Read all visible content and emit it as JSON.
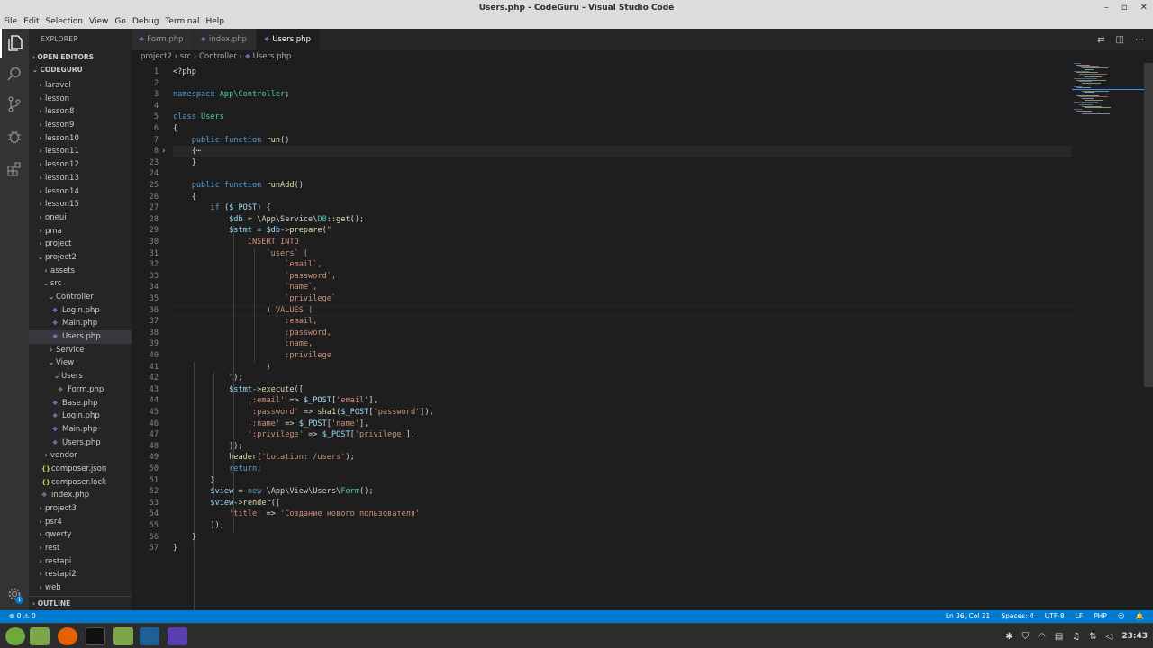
{
  "window": {
    "title": "Users.php - CodeGuru - Visual Studio Code"
  },
  "menu": [
    "File",
    "Edit",
    "Selection",
    "View",
    "Go",
    "Debug",
    "Terminal",
    "Help"
  ],
  "explorer": {
    "title": "EXPLORER",
    "open_editors": "OPEN EDITORS",
    "workspace": "CODEGURU",
    "outline": "OUTLINE",
    "items": [
      {
        "label": "laravel",
        "type": "folder"
      },
      {
        "label": "lesson",
        "type": "folder"
      },
      {
        "label": "lesson8",
        "type": "folder"
      },
      {
        "label": "lesson9",
        "type": "folder"
      },
      {
        "label": "lesson10",
        "type": "folder"
      },
      {
        "label": "lesson11",
        "type": "folder"
      },
      {
        "label": "lesson12",
        "type": "folder"
      },
      {
        "label": "lesson13",
        "type": "folder"
      },
      {
        "label": "lesson14",
        "type": "folder"
      },
      {
        "label": "lesson15",
        "type": "folder"
      },
      {
        "label": "oneui",
        "type": "folder"
      },
      {
        "label": "pma",
        "type": "folder"
      },
      {
        "label": "project",
        "type": "folder"
      },
      {
        "label": "project2",
        "type": "folder-open"
      },
      {
        "label": "assets",
        "type": "folder"
      },
      {
        "label": "src",
        "type": "folder-open"
      },
      {
        "label": "Controller",
        "type": "folder-open"
      },
      {
        "label": "Login.php",
        "type": "php"
      },
      {
        "label": "Main.php",
        "type": "php"
      },
      {
        "label": "Users.php",
        "type": "php",
        "selected": true
      },
      {
        "label": "Service",
        "type": "folder"
      },
      {
        "label": "View",
        "type": "folder-open"
      },
      {
        "label": "Users",
        "type": "folder-open"
      },
      {
        "label": "Form.php",
        "type": "php"
      },
      {
        "label": "Base.php",
        "type": "php"
      },
      {
        "label": "Login.php",
        "type": "php"
      },
      {
        "label": "Main.php",
        "type": "php"
      },
      {
        "label": "Users.php",
        "type": "php"
      },
      {
        "label": "vendor",
        "type": "folder"
      },
      {
        "label": "composer.json",
        "type": "json"
      },
      {
        "label": "composer.lock",
        "type": "json"
      },
      {
        "label": "index.php",
        "type": "php"
      },
      {
        "label": "project3",
        "type": "folder"
      },
      {
        "label": "psr4",
        "type": "folder"
      },
      {
        "label": "qwerty",
        "type": "folder"
      },
      {
        "label": "rest",
        "type": "folder"
      },
      {
        "label": "restapi",
        "type": "folder"
      },
      {
        "label": "restapi2",
        "type": "folder"
      },
      {
        "label": "web",
        "type": "folder"
      }
    ]
  },
  "tabs": [
    {
      "label": "Form.php"
    },
    {
      "label": "index.php"
    },
    {
      "label": "Users.php",
      "active": true
    }
  ],
  "breadcrumb": {
    "p1": "project2",
    "p2": "src",
    "p3": "Controller",
    "p4": "Users.php"
  },
  "code": [
    {
      "n": "1",
      "t": [
        [
          "p",
          "<?php"
        ]
      ]
    },
    {
      "n": "2",
      "t": []
    },
    {
      "n": "3",
      "t": [
        [
          "k",
          "namespace "
        ],
        [
          "c",
          "App\\Controller"
        ],
        [
          "p",
          ";"
        ]
      ]
    },
    {
      "n": "4",
      "t": []
    },
    {
      "n": "5",
      "t": [
        [
          "k",
          "class "
        ],
        [
          "c",
          "Users"
        ]
      ]
    },
    {
      "n": "6",
      "t": [
        [
          "p",
          "{"
        ]
      ]
    },
    {
      "n": "7",
      "t": [
        [
          "p",
          "    "
        ],
        [
          "k",
          "public function "
        ],
        [
          "f",
          "run"
        ],
        [
          "p",
          "()"
        ]
      ]
    },
    {
      "n": "8",
      "t": [
        [
          "p",
          "    {⋯"
        ]
      ]
    },
    {
      "n": "23",
      "t": [
        [
          "p",
          "    }"
        ]
      ]
    },
    {
      "n": "24",
      "t": []
    },
    {
      "n": "25",
      "t": [
        [
          "p",
          "    "
        ],
        [
          "k",
          "public function "
        ],
        [
          "f",
          "runAdd"
        ],
        [
          "p",
          "()"
        ]
      ]
    },
    {
      "n": "26",
      "t": [
        [
          "p",
          "    {"
        ]
      ]
    },
    {
      "n": "27",
      "t": [
        [
          "p",
          "        "
        ],
        [
          "k",
          "if "
        ],
        [
          "p",
          "("
        ],
        [
          "v",
          "$_POST"
        ],
        [
          "p",
          ") {"
        ]
      ]
    },
    {
      "n": "28",
      "t": [
        [
          "p",
          "            "
        ],
        [
          "v",
          "$db"
        ],
        [
          "p",
          " = \\App\\Service\\"
        ],
        [
          "c",
          "DB"
        ],
        [
          "p",
          "::"
        ],
        [
          "f",
          "get"
        ],
        [
          "p",
          "();"
        ]
      ]
    },
    {
      "n": "29",
      "t": [
        [
          "p",
          "            "
        ],
        [
          "v",
          "$stmt"
        ],
        [
          "p",
          " = "
        ],
        [
          "v",
          "$db"
        ],
        [
          "p",
          "->"
        ],
        [
          "f",
          "prepare"
        ],
        [
          "p",
          "("
        ],
        [
          "s",
          "\""
        ]
      ]
    },
    {
      "n": "30",
      "t": [
        [
          "s",
          "                INSERT INTO"
        ]
      ]
    },
    {
      "n": "31",
      "t": [
        [
          "s",
          "                    `users` ("
        ]
      ]
    },
    {
      "n": "32",
      "t": [
        [
          "s",
          "                        `email`,"
        ]
      ]
    },
    {
      "n": "33",
      "t": [
        [
          "s",
          "                        `password`,"
        ]
      ]
    },
    {
      "n": "34",
      "t": [
        [
          "s",
          "                        `name`,"
        ]
      ]
    },
    {
      "n": "35",
      "t": [
        [
          "s",
          "                        `privilege`"
        ]
      ]
    },
    {
      "n": "36",
      "t": [
        [
          "s",
          "                    ) VALUES ("
        ]
      ]
    },
    {
      "n": "37",
      "t": [
        [
          "s",
          "                        :email,"
        ]
      ]
    },
    {
      "n": "38",
      "t": [
        [
          "s",
          "                        :password,"
        ]
      ]
    },
    {
      "n": "39",
      "t": [
        [
          "s",
          "                        :name,"
        ]
      ]
    },
    {
      "n": "40",
      "t": [
        [
          "s",
          "                        :privilege"
        ]
      ]
    },
    {
      "n": "41",
      "t": [
        [
          "s",
          "                    )"
        ]
      ]
    },
    {
      "n": "42",
      "t": [
        [
          "s",
          "            \""
        ],
        [
          "p",
          ");"
        ]
      ]
    },
    {
      "n": "43",
      "t": [
        [
          "p",
          "            "
        ],
        [
          "v",
          "$stmt"
        ],
        [
          "p",
          "->"
        ],
        [
          "f",
          "execute"
        ],
        [
          "p",
          "(["
        ]
      ]
    },
    {
      "n": "44",
      "t": [
        [
          "p",
          "                "
        ],
        [
          "s",
          "':email'"
        ],
        [
          "p",
          " => "
        ],
        [
          "v",
          "$_POST"
        ],
        [
          "p",
          "["
        ],
        [
          "s",
          "'email'"
        ],
        [
          "p",
          "],"
        ]
      ]
    },
    {
      "n": "45",
      "t": [
        [
          "p",
          "                "
        ],
        [
          "s",
          "':password'"
        ],
        [
          "p",
          " => "
        ],
        [
          "f",
          "sha1"
        ],
        [
          "p",
          "("
        ],
        [
          "v",
          "$_POST"
        ],
        [
          "p",
          "["
        ],
        [
          "s",
          "'password'"
        ],
        [
          "p",
          "]),"
        ]
      ]
    },
    {
      "n": "46",
      "t": [
        [
          "p",
          "                "
        ],
        [
          "s",
          "':name'"
        ],
        [
          "p",
          " => "
        ],
        [
          "v",
          "$_POST"
        ],
        [
          "p",
          "["
        ],
        [
          "s",
          "'name'"
        ],
        [
          "p",
          "],"
        ]
      ]
    },
    {
      "n": "47",
      "t": [
        [
          "p",
          "                "
        ],
        [
          "s",
          "':privilege'"
        ],
        [
          "p",
          " => "
        ],
        [
          "v",
          "$_POST"
        ],
        [
          "p",
          "["
        ],
        [
          "s",
          "'privilege'"
        ],
        [
          "p",
          "],"
        ]
      ]
    },
    {
      "n": "48",
      "t": [
        [
          "p",
          "            ]);"
        ]
      ]
    },
    {
      "n": "49",
      "t": [
        [
          "p",
          "            "
        ],
        [
          "f",
          "header"
        ],
        [
          "p",
          "("
        ],
        [
          "s",
          "'Location: /users'"
        ],
        [
          "p",
          ");"
        ]
      ]
    },
    {
      "n": "50",
      "t": [
        [
          "p",
          "            "
        ],
        [
          "k",
          "return"
        ],
        [
          "p",
          ";"
        ]
      ]
    },
    {
      "n": "51",
      "t": [
        [
          "p",
          "        }"
        ]
      ]
    },
    {
      "n": "52",
      "t": [
        [
          "p",
          "        "
        ],
        [
          "v",
          "$view"
        ],
        [
          "p",
          " = "
        ],
        [
          "k",
          "new "
        ],
        [
          "p",
          "\\App\\View\\Users\\"
        ],
        [
          "c",
          "Form"
        ],
        [
          "p",
          "();"
        ]
      ]
    },
    {
      "n": "53",
      "t": [
        [
          "p",
          "        "
        ],
        [
          "v",
          "$view"
        ],
        [
          "p",
          "->"
        ],
        [
          "f",
          "render"
        ],
        [
          "p",
          "(["
        ]
      ]
    },
    {
      "n": "54",
      "t": [
        [
          "p",
          "            "
        ],
        [
          "s",
          "'title'"
        ],
        [
          "p",
          " => "
        ],
        [
          "s",
          "'Создание нового пользователя'"
        ]
      ]
    },
    {
      "n": "55",
      "t": [
        [
          "p",
          "        ]);"
        ]
      ]
    },
    {
      "n": "56",
      "t": [
        [
          "p",
          "    }"
        ]
      ]
    },
    {
      "n": "57",
      "t": [
        [
          "p",
          "}"
        ]
      ]
    }
  ],
  "status": {
    "errors": "0",
    "warnings": "0",
    "position": "Ln 36, Col 31",
    "spaces": "Spaces: 4",
    "encoding": "UTF-8",
    "eol": "LF",
    "language": "PHP"
  },
  "taskbar": {
    "clock": "23:43"
  },
  "colors": {
    "accent": "#007acc",
    "sidebar": "#252526",
    "editor": "#1e1e1e",
    "activitybar": "#333333"
  }
}
